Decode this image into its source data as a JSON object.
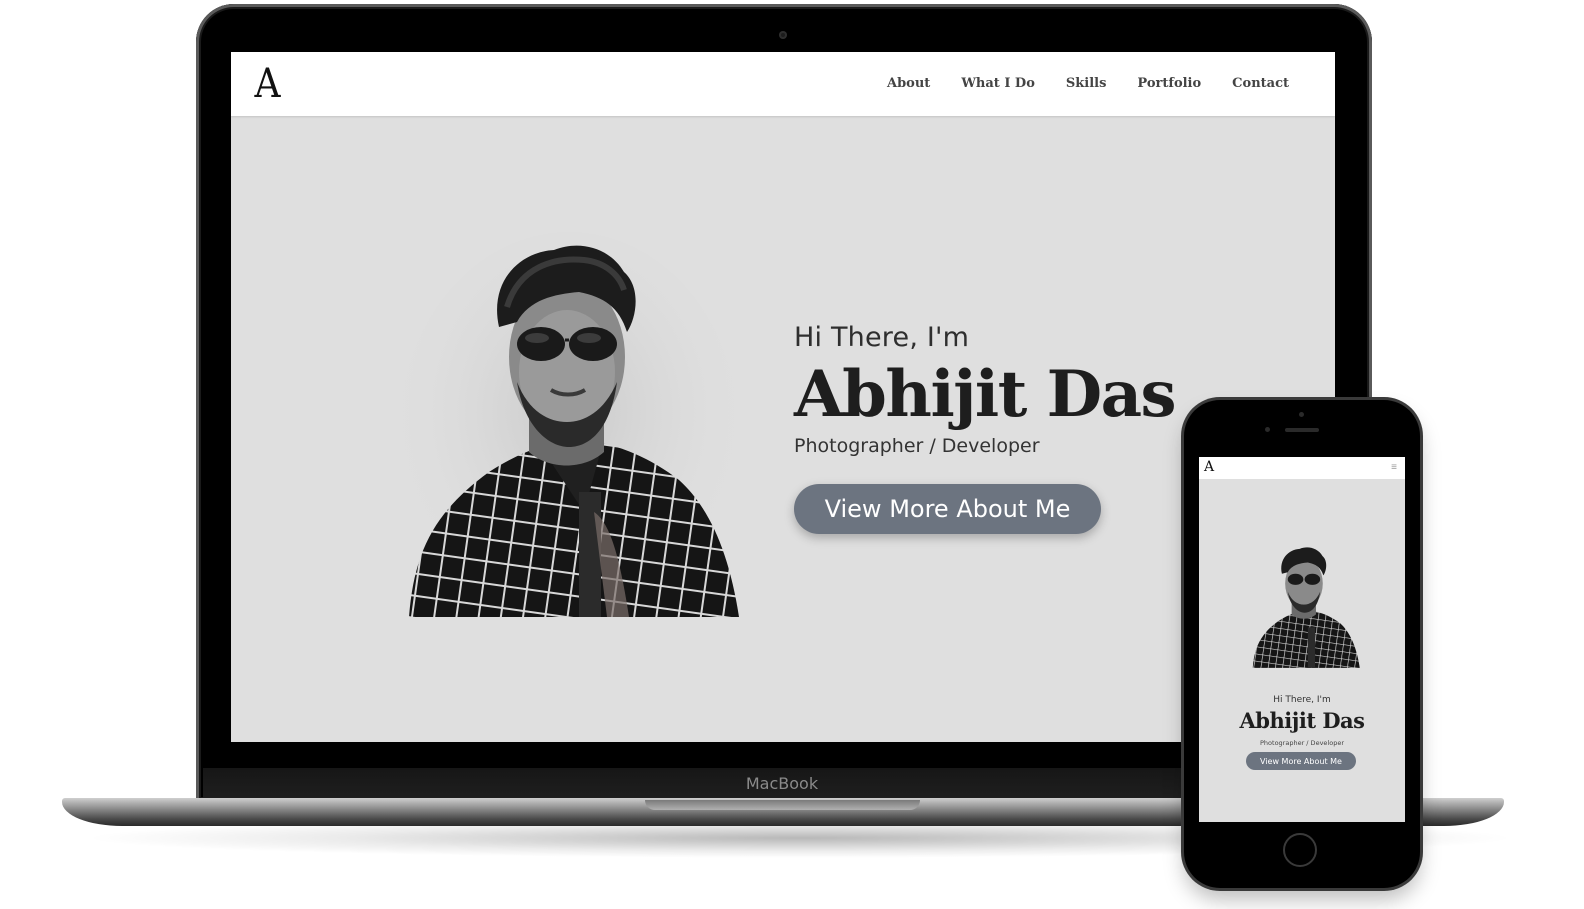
{
  "site": {
    "logo": "A",
    "nav": [
      "About",
      "What I Do",
      "Skills",
      "Portfolio",
      "Contact"
    ],
    "hero": {
      "greeting": "Hi There, I'm",
      "name": "Abhijit Das",
      "role": "Photographer / Developer",
      "cta": "View More About Me"
    }
  },
  "device": {
    "laptop_label": "MacBook"
  },
  "mobile": {
    "logo": "A",
    "menu_icon": "≡",
    "greeting": "Hi There, I'm",
    "name": "Abhijit Das",
    "role": "Photographer / Developer",
    "cta": "View More About Me"
  },
  "colors": {
    "hero_bg": "#dfdfdf",
    "button_bg": "#6c7480",
    "header_bg": "#ffffff",
    "device_frame": "#000000"
  },
  "icons": [
    "logo-mark",
    "hamburger-menu-icon",
    "portrait-photo"
  ]
}
